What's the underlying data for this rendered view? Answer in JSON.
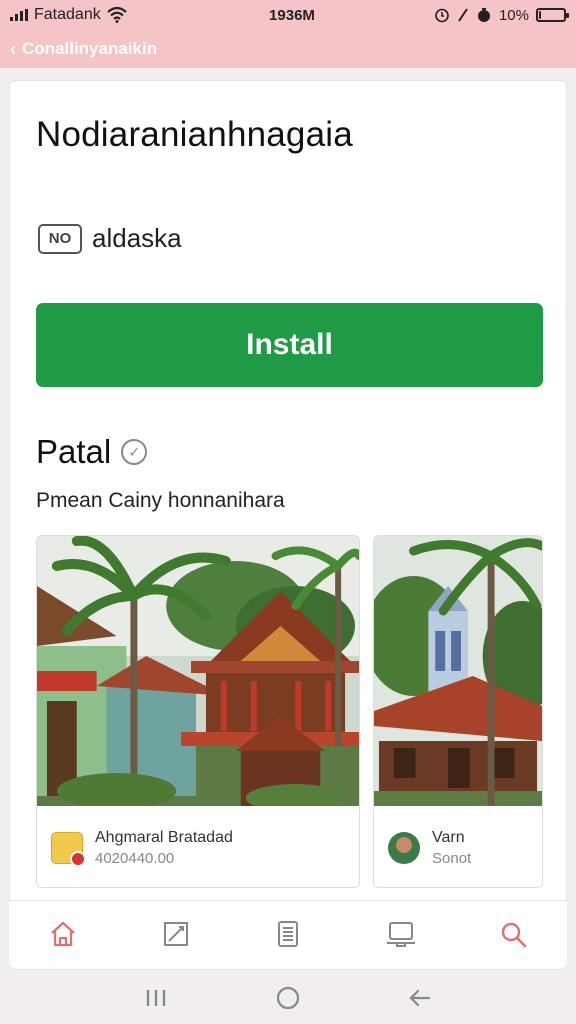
{
  "status_bar": {
    "carrier": "Fatadank",
    "time": "1936M",
    "battery_percent_label": "10%",
    "battery_level": 0.1
  },
  "header": {
    "title": "Conallinyanaikin"
  },
  "app": {
    "title": "Nodiaranianhnagaia",
    "developer_badge": "NO",
    "developer": "aldaska",
    "install_label": "Install"
  },
  "section": {
    "title": "Patal",
    "subtitle": "Pmean Cainy honnanihara"
  },
  "gallery": [
    {
      "title": "Ahgmaral Bratadad",
      "subtitle": "4020440.00"
    },
    {
      "title": "Varn",
      "subtitle": "Sonot"
    }
  ],
  "bottom_nav": [
    "home-icon",
    "edit-icon",
    "document-icon",
    "device-icon",
    "search-icon"
  ],
  "colors": {
    "header_bg": "#f4c4c6",
    "install_green": "#1f9a45",
    "nav_accent": "#e07070"
  }
}
